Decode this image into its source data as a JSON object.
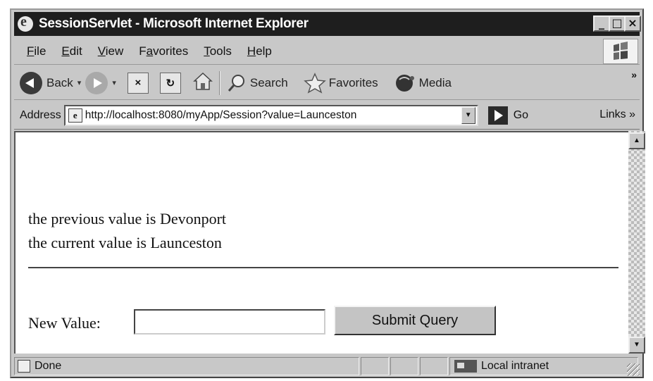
{
  "window": {
    "title": "SessionServlet - Microsoft Internet Explorer",
    "controls": [
      "_",
      "□",
      "×"
    ]
  },
  "menu": {
    "items": [
      {
        "key": "F",
        "rest": "ile"
      },
      {
        "key": "E",
        "rest": "dit"
      },
      {
        "key": "V",
        "rest": "iew"
      },
      {
        "pre": "F",
        "key": "a",
        "rest": "vorites"
      },
      {
        "key": "T",
        "rest": "ools"
      },
      {
        "key": "H",
        "rest": "elp"
      }
    ]
  },
  "toolbar": {
    "back_label": "Back",
    "dropdown_glyph": "▾",
    "stop_glyph": "×",
    "refresh_glyph": "↻",
    "search_label": "Search",
    "favorites_label": "Favorites",
    "media_label": "Media",
    "overflow_glyph": "»"
  },
  "address": {
    "label": "Address",
    "url": "http://localhost:8080/myApp/Session?value=Launceston",
    "dropdown_glyph": "▼",
    "go_label": "Go",
    "links_label": "Links »"
  },
  "page": {
    "previous_line": "the previous value is Devonport",
    "current_line": "the current value is Launceston",
    "form_label": "New Value:",
    "input_value": "",
    "submit_label": "Submit Query"
  },
  "scrollbar": {
    "up_glyph": "▲",
    "down_glyph": "▼"
  },
  "status": {
    "text": "Done",
    "zone": "Local intranet"
  }
}
